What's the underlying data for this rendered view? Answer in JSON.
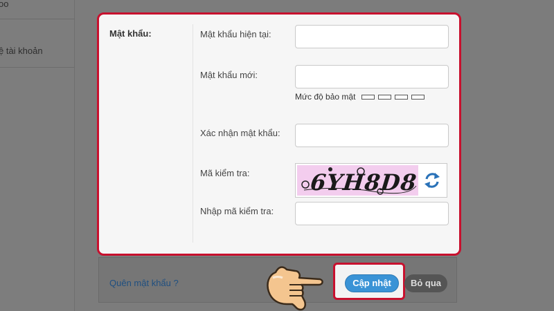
{
  "sidebar": {
    "items": [
      {
        "label": "oo"
      },
      {
        "label": "ệ tài khoản"
      }
    ]
  },
  "modal": {
    "section_label": "Mật khẩu:",
    "current_password_label": "Mật khẩu hiện tại:",
    "current_password_value": "",
    "new_password_label": "Mật khẩu mới:",
    "new_password_value": "",
    "strength_label": "Mức độ bảo mật",
    "strength_level": 0,
    "strength_segments": 4,
    "confirm_password_label": "Xác nhận mật khẩu:",
    "confirm_password_value": "",
    "captcha_label": "Mã kiểm tra:",
    "captcha_text": "6YH8D8",
    "captcha_input_label": "Nhập mã kiểm tra:",
    "captcha_input_value": ""
  },
  "footer": {
    "forgot_link": "Quên mật khẩu ?",
    "update_button": "Cập nhật",
    "skip_button": "Bỏ qua"
  },
  "colors": {
    "highlight": "#c8102e",
    "primary_button": "#3a93d6",
    "refresh_icon": "#2a72b8"
  },
  "icons": {
    "refresh": "refresh-icon",
    "pointer": "pointing-hand-icon"
  }
}
